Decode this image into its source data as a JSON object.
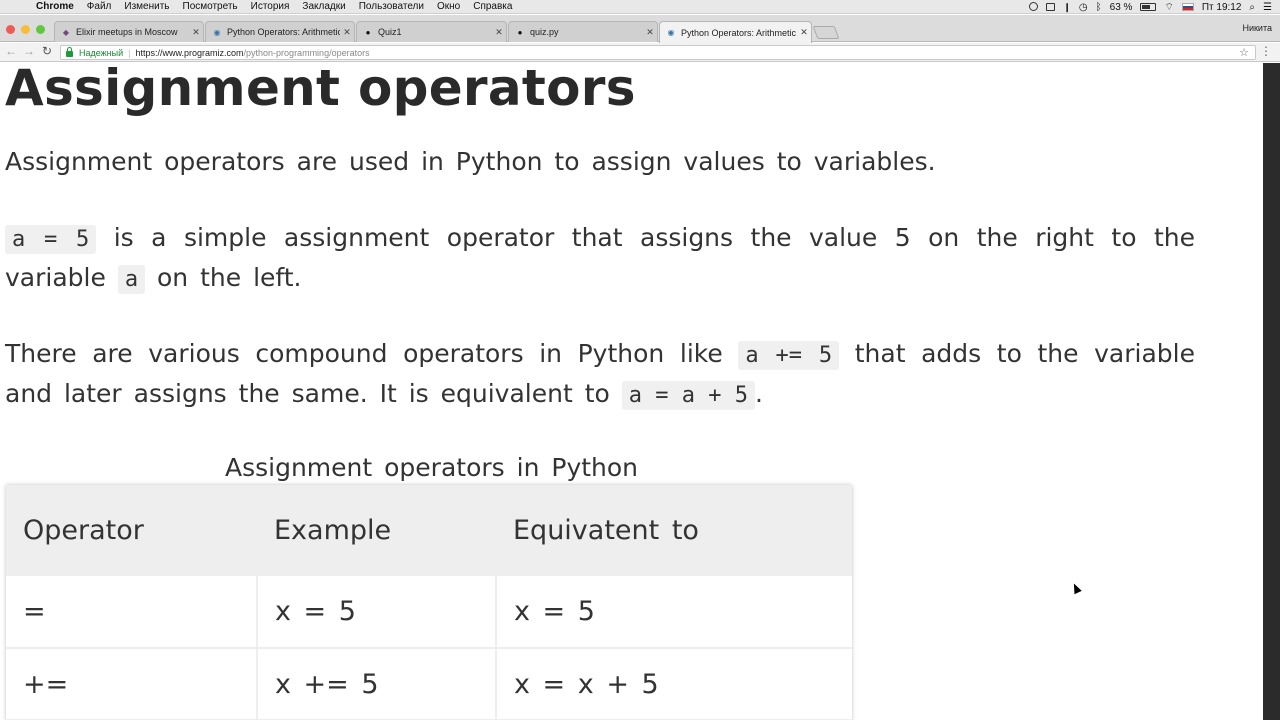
{
  "menubar": {
    "app": "Chrome",
    "items": [
      "Файл",
      "Изменить",
      "Посмотреть",
      "История",
      "Закладки",
      "Пользователи",
      "Окно",
      "Справка"
    ],
    "battery": "63 %",
    "clock": "Пт 19:12"
  },
  "tabs": [
    {
      "title": "Elixir meetups in Moscow",
      "icon": "elixir-icon"
    },
    {
      "title": "Python Operators: Arithmetic",
      "icon": "python-icon"
    },
    {
      "title": "Quiz1",
      "icon": "github-icon"
    },
    {
      "title": "quiz.py",
      "icon": "github-icon"
    },
    {
      "title": "Python Operators: Arithmetic",
      "icon": "python-icon"
    }
  ],
  "profile_name": "Никита",
  "address_bar": {
    "secure_label": "Надежный",
    "url_host": "https://www.programiz.com",
    "url_path": "/python-programming/operators"
  },
  "article": {
    "heading": "Assignment operators",
    "intro": "Assignment operators are used in Python to assign values to variables.",
    "p2_code1": "a = 5",
    "p2_text1": " is a simple assignment operator that assigns the value 5 on the right to the variable ",
    "p2_code2": "a",
    "p2_text2": " on the left.",
    "p3_text1": "There are various compound operators in Python like ",
    "p3_code1": "a += 5",
    "p3_text2": " that adds to the variable and later assigns the same. It is equivalent to ",
    "p3_code2": "a = a + 5",
    "p3_text3": ".",
    "table_caption": "Assignment operators in Python",
    "table": {
      "headers": [
        "Operator",
        "Example",
        "Equivatent to"
      ],
      "rows": [
        [
          "=",
          "x = 5",
          "x = 5"
        ],
        [
          "+=",
          "x += 5",
          "x = x + 5"
        ]
      ]
    }
  }
}
